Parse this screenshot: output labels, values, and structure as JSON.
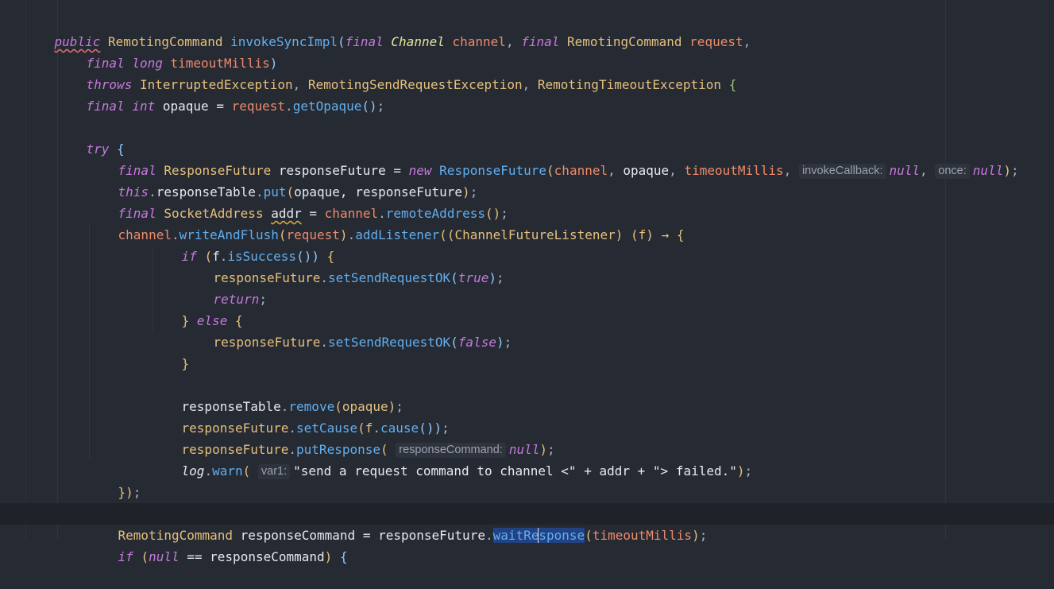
{
  "code": {
    "l1": {
      "public": "public",
      "ret": "RemotingCommand",
      "name": "invokeSyncImpl",
      "op": "(",
      "final1": "final",
      "chType": "Channel",
      "chName": "channel",
      "comma": ",",
      "final2": "final",
      "rcType": "RemotingCommand",
      "reqName": "request",
      "end": ","
    },
    "l2": {
      "final": "final",
      "long": "long",
      "name": "timeoutMillis",
      "cp": ")"
    },
    "l3": {
      "throws": "throws",
      "ex1": "InterruptedException",
      "ex2": "RemotingSendRequestException",
      "ex3": "RemotingTimeoutException",
      "brace": "{"
    },
    "l4": {
      "final": "final",
      "int": "int",
      "name": "opaque",
      "eq": "=",
      "req": "request",
      "dot": ".",
      "fn": "getOpaque",
      "paren": "()",
      "semi": ";"
    },
    "l6": {
      "try": "try",
      "brace": "{"
    },
    "l7": {
      "final": "final",
      "type": "ResponseFuture",
      "name": "responseFuture",
      "eq": "=",
      "new": "new",
      "ctor": "ResponseFuture",
      "op": "(",
      "a1": "channel",
      "a2": "opaque",
      "a3": "timeoutMillis",
      "hint1": "invokeCallback:",
      "null1": "null",
      "hint2": "once:",
      "null2": "null",
      "cp": ")",
      "semi": ";"
    },
    "l8": {
      "this": "this",
      "field": "responseTable",
      "fn": "put",
      "args": "opaque, responseFuture",
      "semi": ";"
    },
    "l9": {
      "final": "final",
      "type": "SocketAddress",
      "name": "addr",
      "eq": "=",
      "ch": "channel",
      "fn": "remoteAddress",
      "paren": "()",
      "semi": ";"
    },
    "l10": {
      "ch": "channel",
      "fn1": "writeAndFlush",
      "req": "request",
      "fn2": "addListener",
      "cast": "(ChannelFutureListener)",
      "f": "(f)",
      "arrow": "→",
      "brace": "{"
    },
    "l11": {
      "if": "if",
      "f": "f",
      "fn": "isSuccess",
      "brace": "{"
    },
    "l12": {
      "obj": "responseFuture",
      "fn": "setSendRequestOK",
      "val": "true",
      "semi": ";"
    },
    "l13": {
      "ret": "return",
      "semi": ";"
    },
    "l14": {
      "close": "}",
      "else": "else",
      "brace": "{"
    },
    "l15": {
      "obj": "responseFuture",
      "fn": "setSendRequestOK",
      "val": "false",
      "semi": ";"
    },
    "l16": {
      "close": "}"
    },
    "l18": {
      "obj": "responseTable",
      "fn": "remove",
      "arg": "opaque",
      "semi": ";"
    },
    "l19": {
      "obj": "responseFuture",
      "fn": "setCause",
      "f": "f",
      "fn2": "cause",
      "semi": ";"
    },
    "l20": {
      "obj": "responseFuture",
      "fn": "putResponse",
      "hint": "responseCommand:",
      "val": "null",
      "semi": ";"
    },
    "l21": {
      "log": "log",
      "fn": "warn",
      "hint": "var1:",
      "s1": "\"send a request command to channel <\"",
      "plus1": "+",
      "addr": "addr",
      "plus2": "+",
      "s2": "\"> failed.\"",
      "semi": ";"
    },
    "l22": {
      "close": "})",
      "semi": ";"
    },
    "l24": {
      "type": "RemotingCommand",
      "name": "responseCommand",
      "eq": "=",
      "obj": "responseFuture",
      "dot": ".",
      "sel1": "waitRe",
      "sel2": "sponse",
      "arg": "timeoutMillis",
      "semi": ";"
    },
    "l25": {
      "if": "if",
      "lit": "null",
      "op": "==",
      "name": "responseCommand",
      "brace": "{"
    }
  }
}
